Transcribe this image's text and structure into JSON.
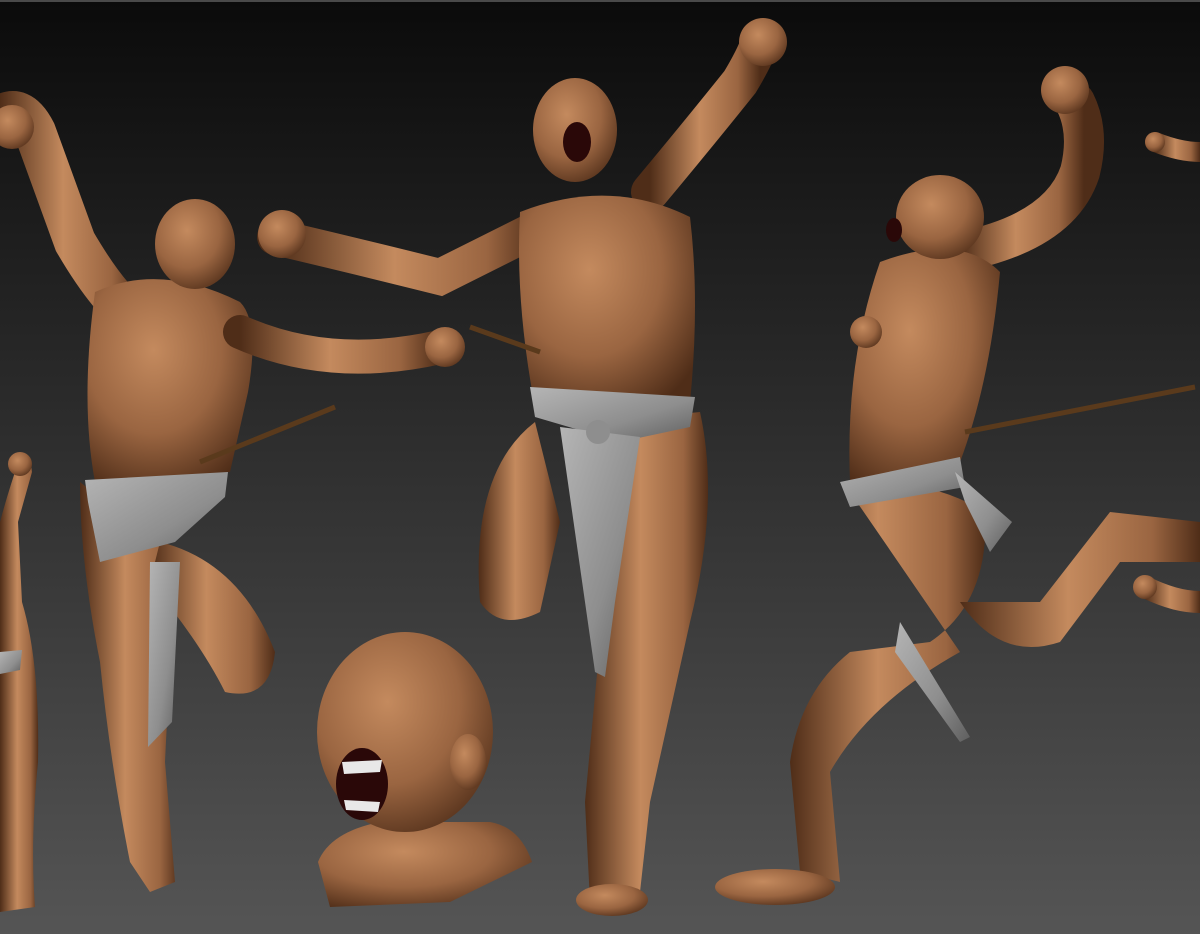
{
  "scene": {
    "background": {
      "top": "#0b0b0b",
      "bottom": "#555555"
    },
    "skin": {
      "light": "#c48a5e",
      "mid": "#9a6541",
      "dark": "#4f2d18"
    },
    "cloth": {
      "light": "#b5b5b5",
      "mid": "#8e8e8e",
      "dark": "#5e5e5e"
    },
    "spear": "#5a3a1c",
    "mouth": "#2a0808",
    "teeth": "#e8e8e8",
    "figures": [
      "partial-figure-left",
      "back-view-figure",
      "front-view-figure",
      "side-view-figure",
      "partial-figure-right"
    ],
    "bust": "head-bust-screaming"
  }
}
